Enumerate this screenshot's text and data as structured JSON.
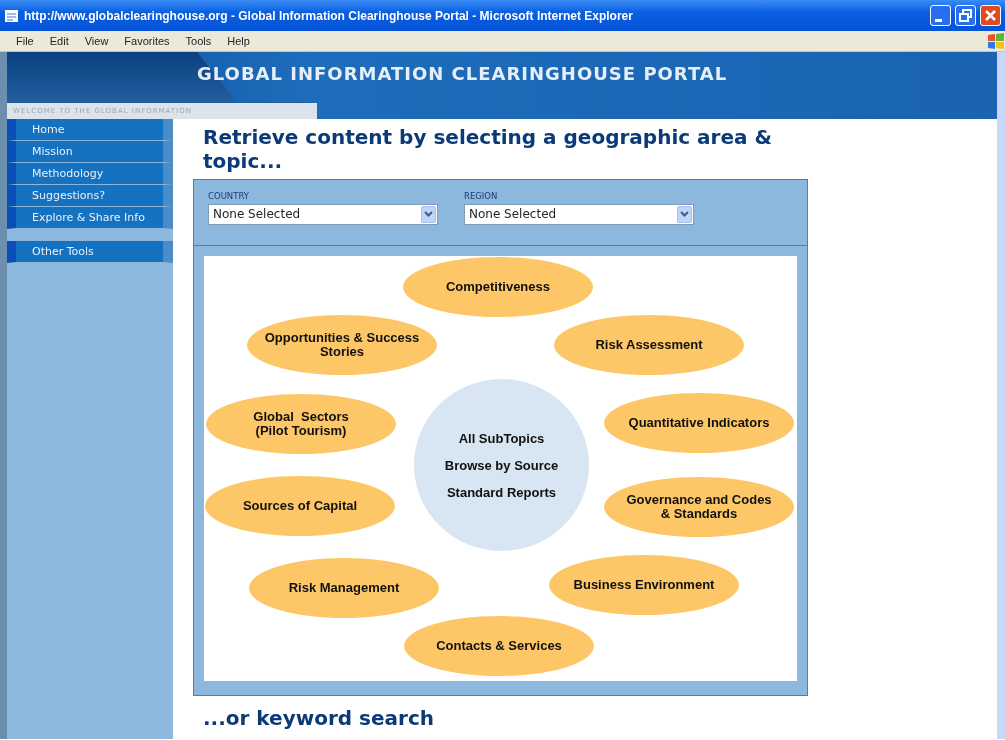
{
  "window": {
    "title": "http://www.globalclearinghouse.org - Global Information Clearinghouse Portal - Microsoft Internet Explorer"
  },
  "menu": [
    "File",
    "Edit",
    "View",
    "Favorites",
    "Tools",
    "Help"
  ],
  "banner": {
    "title": "GLOBAL INFORMATION CLEARINGHOUSE PORTAL",
    "welcome": "WELCOME TO THE GLOBAL INFORMATION"
  },
  "sidebar": {
    "groups": [
      {
        "items": [
          "Home",
          "Mission",
          "Methodology",
          "Suggestions?",
          "Explore & Share Info"
        ]
      },
      {
        "items": [
          "Other Tools"
        ]
      }
    ]
  },
  "heading": "Retrieve content by selecting a geographic area & topic...",
  "filters": [
    {
      "label": "COUNTRY",
      "value": "None Selected"
    },
    {
      "label": "REGION",
      "value": "None Selected"
    }
  ],
  "topics": [
    {
      "lines": [
        "Competitiveness"
      ]
    },
    {
      "lines": [
        "Opportunities & Success",
        "Stories"
      ]
    },
    {
      "lines": [
        "Risk Assessment"
      ]
    },
    {
      "lines": [
        "Global  Sectors",
        "(Pilot Tourism)"
      ]
    },
    {
      "lines": [
        "Quantitative Indicators"
      ]
    },
    {
      "lines": [
        "Sources of Capital"
      ]
    },
    {
      "lines": [
        "Governance and Codes",
        "& Standards"
      ]
    },
    {
      "lines": [
        "Risk Management"
      ]
    },
    {
      "lines": [
        "Business Environment"
      ]
    },
    {
      "lines": [
        "Contacts & Services"
      ]
    }
  ],
  "center_links": [
    "All SubTopics",
    "Browse by Source",
    "Standard Reports"
  ],
  "keyword_heading": "...or keyword search"
}
